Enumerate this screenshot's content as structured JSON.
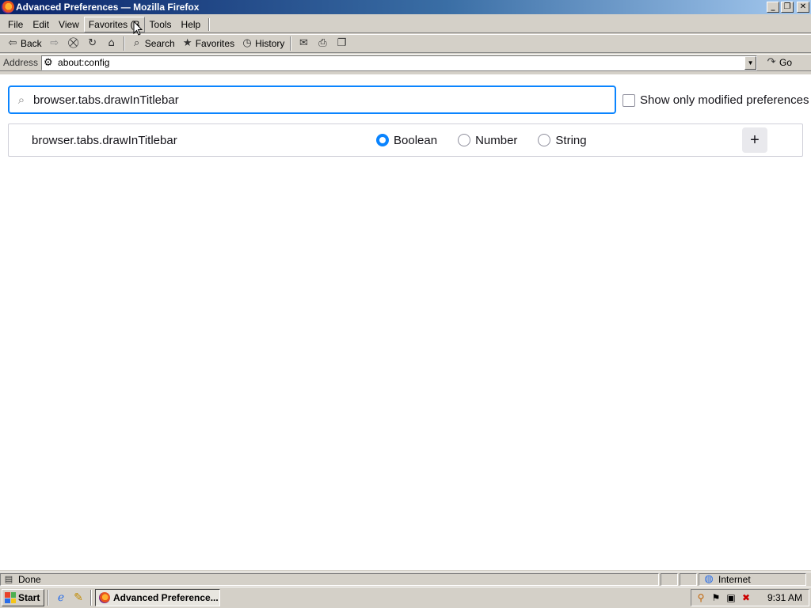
{
  "window": {
    "title": "Advanced Preferences — Mozilla Firefox",
    "minimize": "_",
    "maximize": "❐",
    "close": "✕"
  },
  "menu": {
    "items": [
      "File",
      "Edit",
      "View",
      "Favorites (B",
      "Tools",
      "Help"
    ]
  },
  "toolbar": {
    "back_label": "Back",
    "search_label": "Search",
    "favorites_label": "Favorites",
    "history_label": "History"
  },
  "address": {
    "label": "Address",
    "url": "about:config",
    "go_label": "Go"
  },
  "config": {
    "search_value": "browser.tabs.drawInTitlebar",
    "show_modified_label": "Show only modified preferences",
    "show_modified_checked": false,
    "pref_name": "browser.tabs.drawInTitlebar",
    "types": [
      "Boolean",
      "Number",
      "String"
    ],
    "selected_type": "Boolean",
    "add_label": "+"
  },
  "status": {
    "text": "Done",
    "zone": "Internet"
  },
  "taskbar": {
    "start_label": "Start",
    "task_label": "Advanced Preference...",
    "clock": "9:31 AM"
  },
  "colors": {
    "accent": "#0a84ff",
    "titlebar_start": "#0a246a",
    "chrome": "#d4d0c8"
  }
}
